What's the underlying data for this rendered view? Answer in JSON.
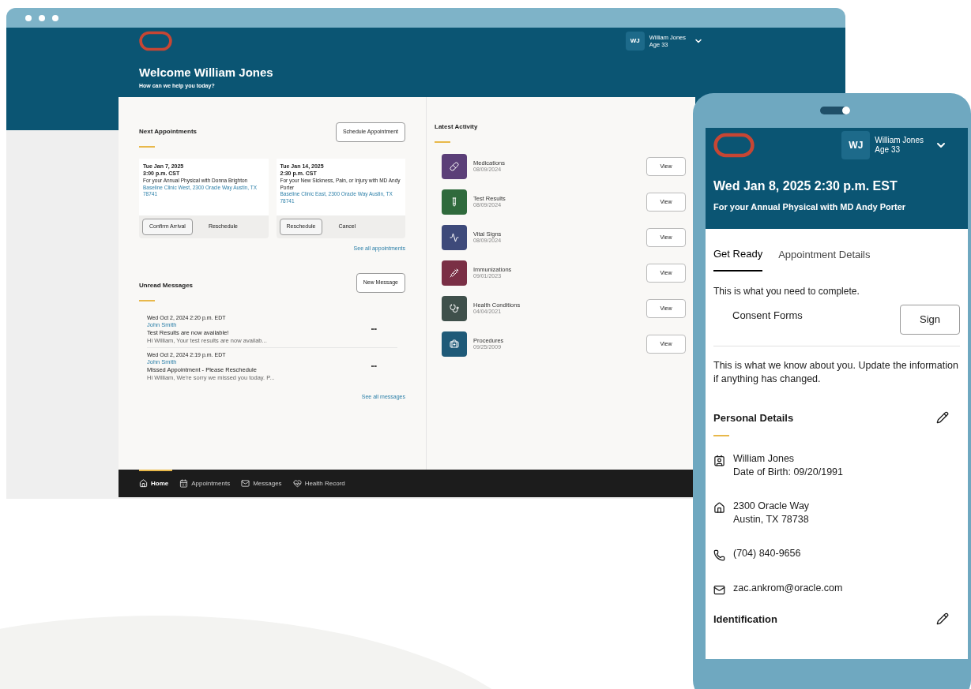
{
  "browser": {
    "header": {
      "user_initials": "WJ",
      "user_name": "William Jones",
      "user_age": "Age 33",
      "title": "Welcome William Jones",
      "subtitle": "How can we help you today?"
    },
    "next_appointments": {
      "title": "Next Appointments",
      "action": "Schedule Appointment",
      "cards": [
        {
          "date": "Tue Jan 7, 2025",
          "time": "3:00 p.m. CST",
          "description": "For your Annual Physical with Donna Brighton",
          "location": "Baseline Clinic West, 2300 Oracle Way Austin, TX 78741",
          "actions": [
            {
              "label": "Confirm Arrival",
              "kind": "outlined"
            },
            {
              "label": "Reschedule",
              "kind": "text"
            }
          ]
        },
        {
          "date": "Tue Jan 14, 2025",
          "time": "2:30 p.m. CST",
          "description": "For your New Sickness, Pain, or Injury with MD Andy Porter",
          "location": "Baseline Clinic East, 2300 Oracle Way Austin, TX 78741",
          "actions": [
            {
              "label": "Reschedule",
              "kind": "outlined"
            },
            {
              "label": "Cancel",
              "kind": "text"
            }
          ]
        }
      ],
      "see_all": "See all appointments"
    },
    "unread_messages": {
      "title": "Unread Messages",
      "action": "New Message",
      "messages": [
        {
          "datetime": "Wed Oct 2, 2024 2:20 p.m. EDT",
          "sender": "John Smith",
          "subject": "Test Results are now available!",
          "preview": "Hi William, Your test results are now availab...",
          "menu": "•••"
        },
        {
          "datetime": "Wed Oct 2, 2024 2:19 p.m. EDT",
          "sender": "John Smith",
          "subject": "Missed Appointment - Please Reschedule",
          "preview": "Hi William, We're sorry we missed you today. P...",
          "menu": "•••"
        }
      ],
      "see_all": "See all messages"
    },
    "latest_activity": {
      "title": "Latest Activity",
      "items": [
        {
          "kind": "pill",
          "label": "Medications",
          "date": "08/09/2024",
          "color": "#5b3f78",
          "action": "View"
        },
        {
          "kind": "tube",
          "label": "Test Results",
          "date": "08/09/2024",
          "color": "#2f6a3c",
          "action": "View"
        },
        {
          "kind": "monitor",
          "label": "Vital Signs",
          "date": "08/09/2024",
          "color": "#3e4a7a",
          "action": "View"
        },
        {
          "kind": "syringe",
          "label": "Immunizations",
          "date": "09/01/2023",
          "color": "#7a2f45",
          "action": "View"
        },
        {
          "kind": "conditions",
          "label": "Health Conditions",
          "date": "04/04/2021",
          "color": "#3f504b",
          "action": "View"
        },
        {
          "kind": "kit",
          "label": "Procedures",
          "date": "09/25/2009",
          "color": "#1f5a78",
          "action": "View"
        }
      ]
    },
    "nav": [
      {
        "kind": "home",
        "label": "Home",
        "selected": true
      },
      {
        "kind": "calendar",
        "label": "Appointments",
        "selected": false
      },
      {
        "kind": "mail",
        "label": "Messages",
        "selected": false
      },
      {
        "kind": "heart",
        "label": "Health Record",
        "selected": false
      }
    ]
  },
  "phone": {
    "header": {
      "user_initials": "WJ",
      "user_name": "William Jones",
      "user_age": "Age 33",
      "title": "Wed Jan 8, 2025 2:30 p.m. EST",
      "subtitle": "For your Annual Physical with MD Andy Porter"
    },
    "tabs": [
      {
        "label": "Get Ready",
        "selected": true
      },
      {
        "label": "Appointment Details",
        "selected": false
      }
    ],
    "intro": "This is what you need to complete.",
    "task": {
      "label": "Consent Forms",
      "action": "Sign"
    },
    "info": "This is what we know about you. Update the information if anything has changed.",
    "sections": [
      {
        "title": "Personal Details",
        "details": [
          {
            "kind": "person",
            "lines": [
              "William Jones",
              "Date of Birth: 09/20/1991"
            ]
          },
          {
            "kind": "home",
            "lines": [
              "2300 Oracle Way",
              "Austin, TX 78738"
            ]
          },
          {
            "kind": "phone",
            "lines": [
              "(704) 840-9656"
            ]
          },
          {
            "kind": "mail",
            "lines": [
              "zac.ankrom@oracle.com"
            ]
          }
        ]
      },
      {
        "title": "Identification"
      }
    ]
  }
}
